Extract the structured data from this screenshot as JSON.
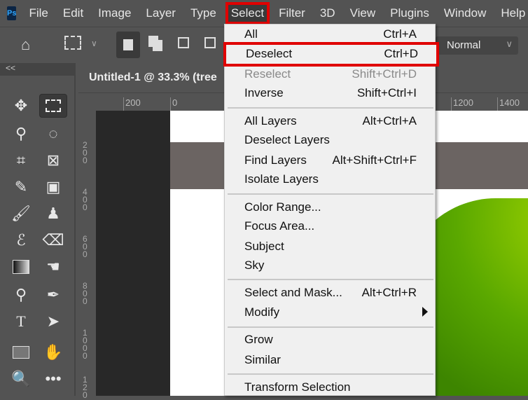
{
  "menubar": {
    "logo": "Ps",
    "items": [
      "File",
      "Edit",
      "Image",
      "Layer",
      "Type",
      "Select",
      "Filter",
      "3D",
      "View",
      "Plugins",
      "Window",
      "Help"
    ]
  },
  "options": {
    "blend_mode": "Normal"
  },
  "toolbar": {
    "collapse": "<<"
  },
  "document": {
    "tab_title": "Untitled-1 @ 33.3% (tree"
  },
  "rulers": {
    "horizontal": [
      "200",
      "0",
      "1200",
      "1400"
    ],
    "vertical": [
      "200",
      "400",
      "600",
      "800",
      "1000",
      "120"
    ]
  },
  "select_menu": {
    "items": [
      {
        "label": "All",
        "shortcut": "Ctrl+A"
      },
      {
        "label": "Deselect",
        "shortcut": "Ctrl+D"
      },
      {
        "label": "Reselect",
        "shortcut": "Shift+Ctrl+D"
      },
      {
        "label": "Inverse",
        "shortcut": "Shift+Ctrl+I"
      },
      {
        "label": "All Layers",
        "shortcut": "Alt+Ctrl+A"
      },
      {
        "label": "Deselect Layers",
        "shortcut": ""
      },
      {
        "label": "Find Layers",
        "shortcut": "Alt+Shift+Ctrl+F"
      },
      {
        "label": "Isolate Layers",
        "shortcut": ""
      },
      {
        "label": "Color Range...",
        "shortcut": ""
      },
      {
        "label": "Focus Area...",
        "shortcut": ""
      },
      {
        "label": "Subject",
        "shortcut": ""
      },
      {
        "label": "Sky",
        "shortcut": ""
      },
      {
        "label": "Select and Mask...",
        "shortcut": "Alt+Ctrl+R"
      },
      {
        "label": "Modify",
        "shortcut": ""
      },
      {
        "label": "Grow",
        "shortcut": ""
      },
      {
        "label": "Similar",
        "shortcut": ""
      },
      {
        "label": "Transform Selection",
        "shortcut": ""
      }
    ]
  },
  "colors": {
    "highlight": "#e00000",
    "menu_bg": "#f0f0f0",
    "ui_bg": "#535353"
  }
}
